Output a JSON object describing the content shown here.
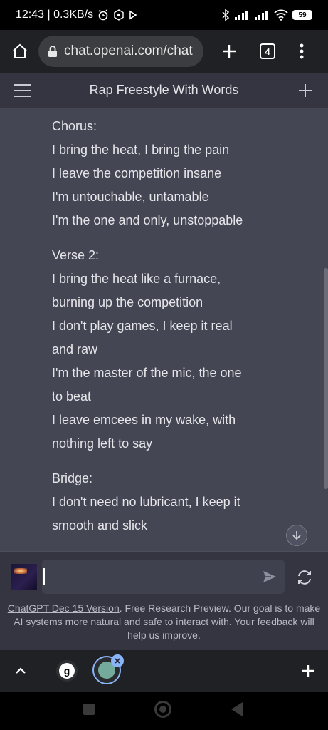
{
  "status_bar": {
    "time_speed": "12:43 | 0.3KB/s",
    "icons": [
      "alarm-icon",
      "settings-hex-icon",
      "play-icon",
      "bluetooth-icon",
      "signal-icon",
      "signal-icon",
      "wifi-icon"
    ],
    "battery": "59"
  },
  "browser": {
    "url": "chat.openai.com/chat",
    "tab_count": "4"
  },
  "chat": {
    "title": "Rap Freestyle With Words"
  },
  "message": {
    "chorus": [
      "Chorus:",
      "I bring the heat, I bring the pain",
      "I leave the competition insane",
      "I'm untouchable, untamable",
      "I'm the one and only, unstoppable"
    ],
    "verse2": [
      "Verse 2:",
      "I bring the heat like a furnace,",
      "burning up the competition",
      "I don't play games, I keep it real",
      "and raw",
      "I'm the master of the mic, the one",
      "to beat",
      "I leave emcees in my wake, with",
      "nothing left to say"
    ],
    "bridge": [
      "Bridge:",
      "I don't need no lubricant, I keep it",
      "smooth and slick"
    ]
  },
  "input": {
    "value": "",
    "footer_link": "ChatGPT Dec 15 Version",
    "footer_text": ". Free Research Preview. Our goal is to make AI systems more natural and safe to interact with. Your feedback will help us improve."
  },
  "colors": {
    "content_bg": "#444654",
    "header_bg": "#343541",
    "browser_bg": "#202124",
    "accent": "#8ab4f8"
  }
}
